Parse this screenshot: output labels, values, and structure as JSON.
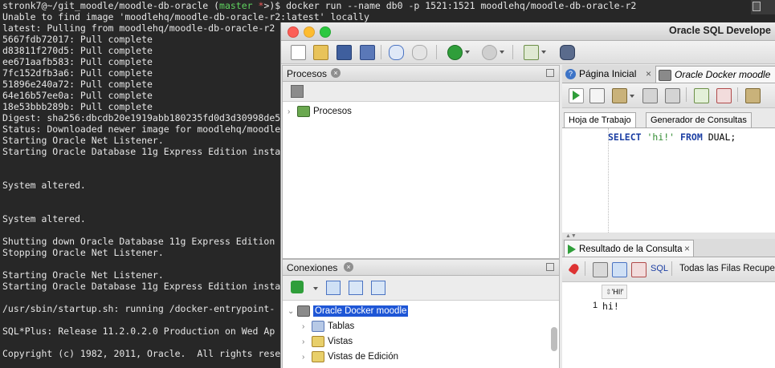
{
  "terminal": {
    "lines": [
      [
        {
          "t": "stronk7@~/git_moodle/moodle-db-oracle ("
        },
        {
          "t": "master",
          "c": "green"
        },
        {
          "t": " *",
          "c": "red"
        },
        {
          "t": ">)$ docker run --name db0 -p 1521:1521 moodlehq/moodle-db-oracle-r2"
        }
      ],
      [
        {
          "t": "Unable to find image 'moodlehq/moodle-db-oracle-r2:latest' locally"
        }
      ],
      [
        {
          "t": "latest: Pulling from moodlehq/moodle-db-oracle-r2"
        }
      ],
      [
        {
          "t": "5667fdb72017: Pull complete"
        }
      ],
      [
        {
          "t": "d83811f270d5: Pull complete"
        }
      ],
      [
        {
          "t": "ee671aafb583: Pull complete"
        }
      ],
      [
        {
          "t": "7fc152dfb3a6: Pull complete"
        }
      ],
      [
        {
          "t": "51896e240a72: Pull complete"
        }
      ],
      [
        {
          "t": "64e16b57ee0a: Pull complete"
        }
      ],
      [
        {
          "t": "18e53bbb289b: Pull complete"
        }
      ],
      [
        {
          "t": "Digest: sha256:dbcdb20e1919abb180235fd0d3d30998de5"
        }
      ],
      [
        {
          "t": "Status: Downloaded newer image for moodlehq/moodle"
        }
      ],
      [
        {
          "t": "Starting Oracle Net Listener."
        }
      ],
      [
        {
          "t": "Starting Oracle Database 11g Express Edition insta"
        }
      ],
      [
        {
          "t": ""
        }
      ],
      [
        {
          "t": ""
        }
      ],
      [
        {
          "t": "System altered."
        }
      ],
      [
        {
          "t": ""
        }
      ],
      [
        {
          "t": ""
        }
      ],
      [
        {
          "t": "System altered."
        }
      ],
      [
        {
          "t": ""
        }
      ],
      [
        {
          "t": "Shutting down Oracle Database 11g Express Edition"
        }
      ],
      [
        {
          "t": "Stopping Oracle Net Listener."
        }
      ],
      [
        {
          "t": ""
        }
      ],
      [
        {
          "t": "Starting Oracle Net Listener."
        }
      ],
      [
        {
          "t": "Starting Oracle Database 11g Express Edition insta"
        }
      ],
      [
        {
          "t": ""
        }
      ],
      [
        {
          "t": "/usr/sbin/startup.sh: running /docker-entrypoint-"
        }
      ],
      [
        {
          "t": ""
        }
      ],
      [
        {
          "t": "SQL*Plus: Release 11.2.0.2.0 Production on Wed Ap"
        }
      ],
      [
        {
          "t": ""
        }
      ],
      [
        {
          "t": "Copyright (c) 1982, 2011, Oracle.  All rights rese"
        }
      ]
    ]
  },
  "window": {
    "title": "Oracle SQL Develope"
  },
  "procesos_pane": {
    "title": "Procesos",
    "tree": [
      {
        "label": "Procesos"
      }
    ]
  },
  "conexiones_pane": {
    "title": "Conexiones",
    "connection": "Oracle Docker moodle",
    "children": [
      {
        "label": "Tablas"
      },
      {
        "label": "Vistas"
      },
      {
        "label": "Vistas de Edición"
      }
    ]
  },
  "editor": {
    "tabs": [
      {
        "label": "Página Inicial"
      },
      {
        "label": "Oracle Docker moodle"
      }
    ],
    "subtabs": [
      {
        "label": "Hoja de Trabajo"
      },
      {
        "label": "Generador de Consultas"
      }
    ],
    "sql": {
      "kw1": "SELECT",
      "str": "'hi!'",
      "kw2": "FROM",
      "rest": "DUAL;"
    }
  },
  "results": {
    "tab_label": "Resultado de la Consulta",
    "sql_label": "SQL",
    "status": "Todas las Filas Recupe",
    "column": "'HI!'",
    "rows": [
      {
        "num": "1",
        "value": "hi!"
      }
    ]
  },
  "colors": {
    "selection": "#1e56d6",
    "terminal_bg": "#272727",
    "accent_green": "#2bc840"
  }
}
